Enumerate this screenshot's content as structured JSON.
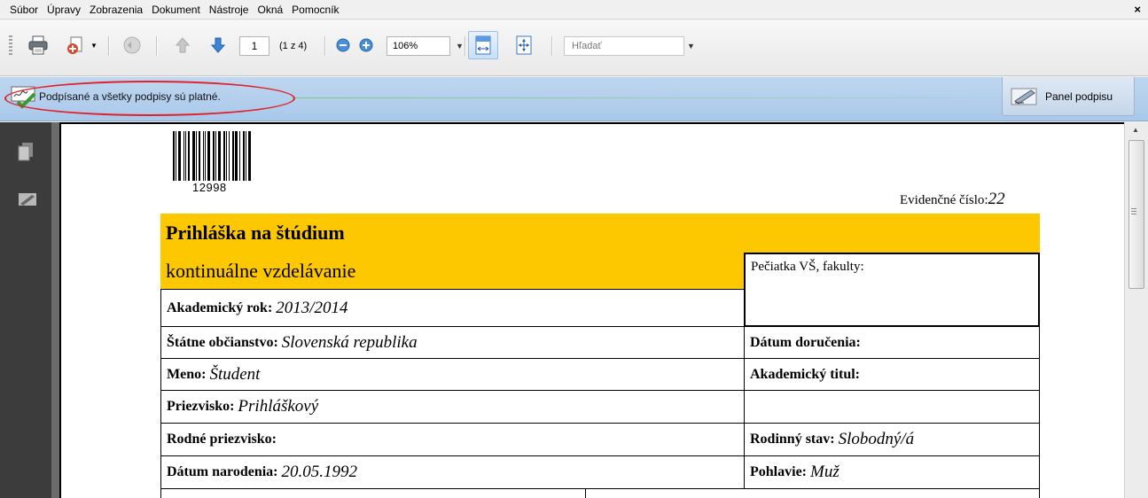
{
  "menu": [
    "Súbor",
    "Úpravy",
    "Zobrazenia",
    "Dokument",
    "Nástroje",
    "Okná",
    "Pomocník"
  ],
  "menu_close": "×",
  "toolbar": {
    "page_value": "1",
    "page_info": "(1 z 4)",
    "zoom_value": "106%",
    "search_placeholder": "Hľadať"
  },
  "signature_bar": {
    "message": "Podpísané a všetky podpisy sú platné.",
    "panel_button": "Panel podpisu"
  },
  "document": {
    "barcode_number": "12998",
    "evidence_label": "Evidenčné číslo:",
    "evidence_value": "22",
    "title": "Prihláška na štúdium",
    "subtitle": "kontinuálne vzdelávanie",
    "stamp_label": "Pečiatka VŠ, fakulty:",
    "rows_left": [
      {
        "label": "Akademický rok:",
        "value": "2013/2014"
      },
      {
        "label": "Štátne občianstvo:",
        "value": "Slovenská republika"
      },
      {
        "label": "Meno:",
        "value": "Študent"
      },
      {
        "label": "Priezvisko:",
        "value": "Prihláškový"
      },
      {
        "label": "Rodné priezvisko:",
        "value": ""
      },
      {
        "label": "Dátum narodenia:",
        "value": "20.05.1992"
      }
    ],
    "rows_right": [
      {
        "label": "Dátum doručenia:",
        "value": ""
      },
      {
        "label": "Akademický titul:",
        "value": ""
      },
      {
        "label": "",
        "value": ""
      },
      {
        "label": "Rodinný stav:",
        "value": "Slobodný/á"
      },
      {
        "label": "Pohlavie:",
        "value": "Muž"
      }
    ]
  },
  "colors": {
    "form_header": "#fdc800",
    "signature_bar": "#b4cfee",
    "highlight_oval": "#e0202a"
  }
}
